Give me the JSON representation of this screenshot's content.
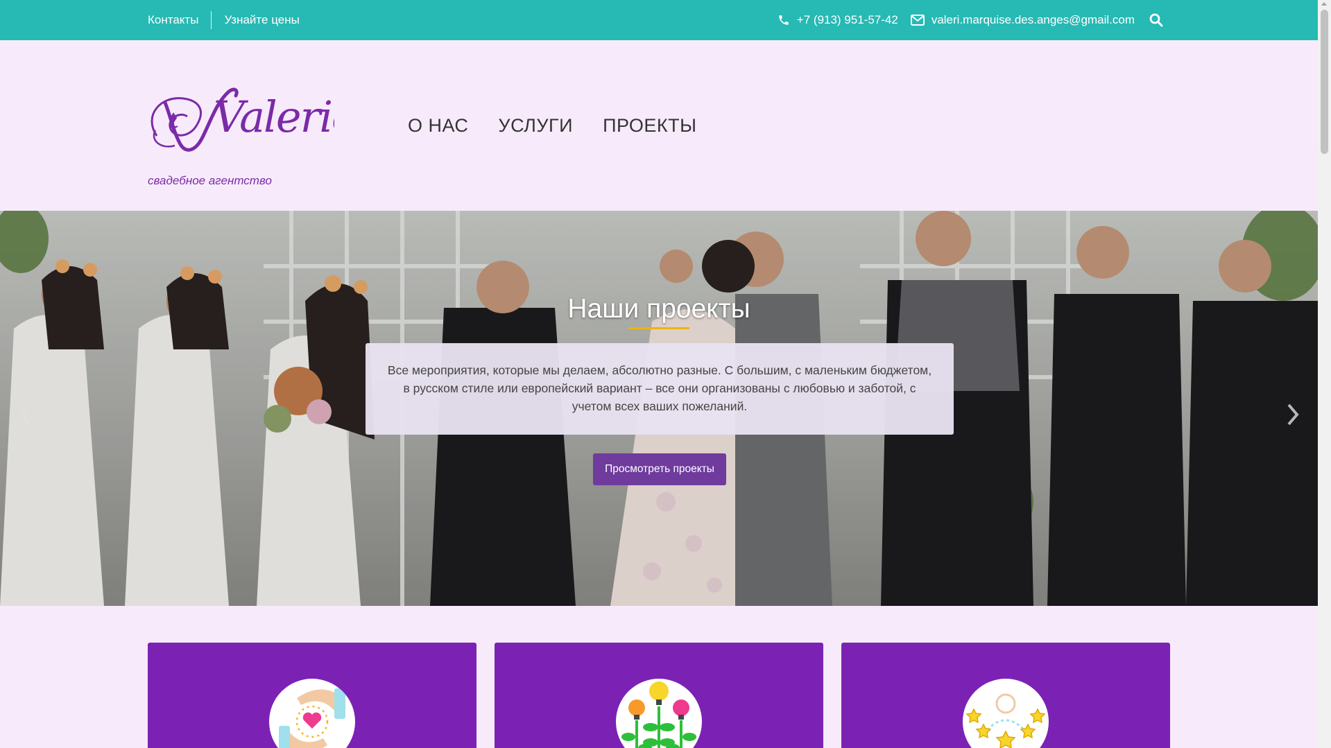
{
  "topbar": {
    "links": [
      "Контакты",
      "Узнайте цены"
    ],
    "phone": "+7 (913) 951-57-42",
    "email": "valeri.marquise.des.anges@gmail.com",
    "icons": [
      "phone-icon",
      "envelope-icon",
      "search-icon"
    ],
    "color": "#27b9b4"
  },
  "header": {
    "logo_text": "Valerie",
    "tagline": "свадебное агентство",
    "nav": [
      "О НАС",
      "УСЛУГИ",
      "ПРОЕКТЫ"
    ]
  },
  "hero": {
    "title": "Наши проекты",
    "description": "Все мероприятия, которые мы делаем, абсолютно разные. С большим, с маленьким бюджетом, в русском стиле или европейский вариант – все они организованы с любовью и заботой, с учетом всех ваших пожеланий.",
    "button": "Просмотреть проекты",
    "accent": "#f0b400",
    "button_color": "#6f3b9d"
  },
  "cards": [
    {
      "icon": "heart-hands-icon"
    },
    {
      "icon": "idea-plants-icon"
    },
    {
      "icon": "star-person-icon"
    }
  ],
  "colors": {
    "background": "#f7ebfb",
    "card": "#7b22b5",
    "brand": "#7b2aa8"
  }
}
